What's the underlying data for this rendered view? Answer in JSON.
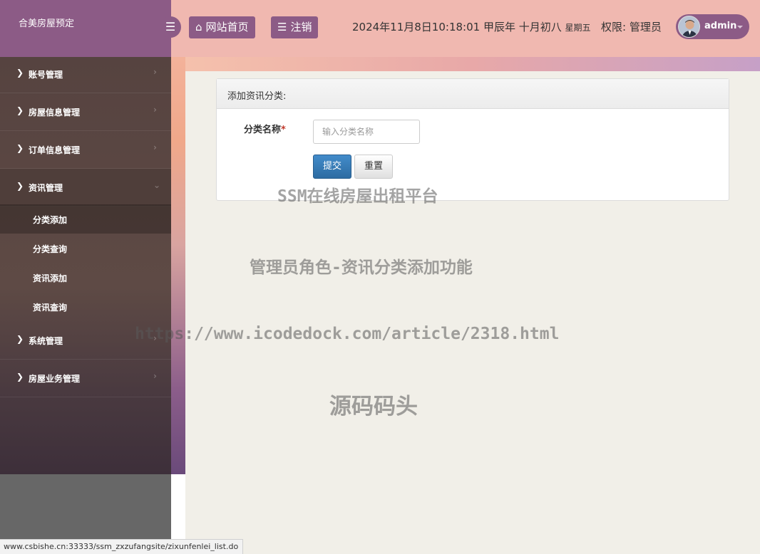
{
  "brand": {
    "title": "合美房屋预定"
  },
  "header": {
    "menu_toggle_icon": "hamburger-icon",
    "home_label": "网站首页",
    "home_icon": "home-icon",
    "logout_label": "注销",
    "logout_icon": "list-icon",
    "datetime": "2024年11月8日10:18:01 甲辰年 十月初八",
    "weekday": "星期五",
    "permission": "权限: 管理员",
    "username": "admin"
  },
  "sidebar": {
    "items": [
      {
        "label": "账号管理"
      },
      {
        "label": "房屋信息管理"
      },
      {
        "label": "订单信息管理"
      },
      {
        "label": "资讯管理"
      },
      {
        "label": "系统管理"
      },
      {
        "label": "房屋业务管理"
      }
    ],
    "subitems": [
      {
        "label": "分类添加"
      },
      {
        "label": "分类查询"
      },
      {
        "label": "资讯添加"
      },
      {
        "label": "资讯查询"
      }
    ]
  },
  "form": {
    "panel_title": "添加资讯分类:",
    "field_label": "分类名称",
    "required_mark": "*",
    "placeholder": "输入分类名称",
    "value": "",
    "submit_label": "提交",
    "reset_label": "重置"
  },
  "watermarks": {
    "line1": "SSM在线房屋出租平台",
    "line2": "管理员角色-资讯分类添加功能",
    "line3": "https://www.icodedock.com/article/2318.html",
    "line4": "源码码头"
  },
  "statusbar": {
    "url": "www.csbishe.cn:33333/ssm_zxzufangsite/zixunfenlei_list.do"
  },
  "colors": {
    "header_bg": "#f0b8b0",
    "brand_bg": "#8c5b86",
    "content_bg": "#f1efe8",
    "primary_button": "#2d6ca2",
    "required": "#c0392b"
  }
}
